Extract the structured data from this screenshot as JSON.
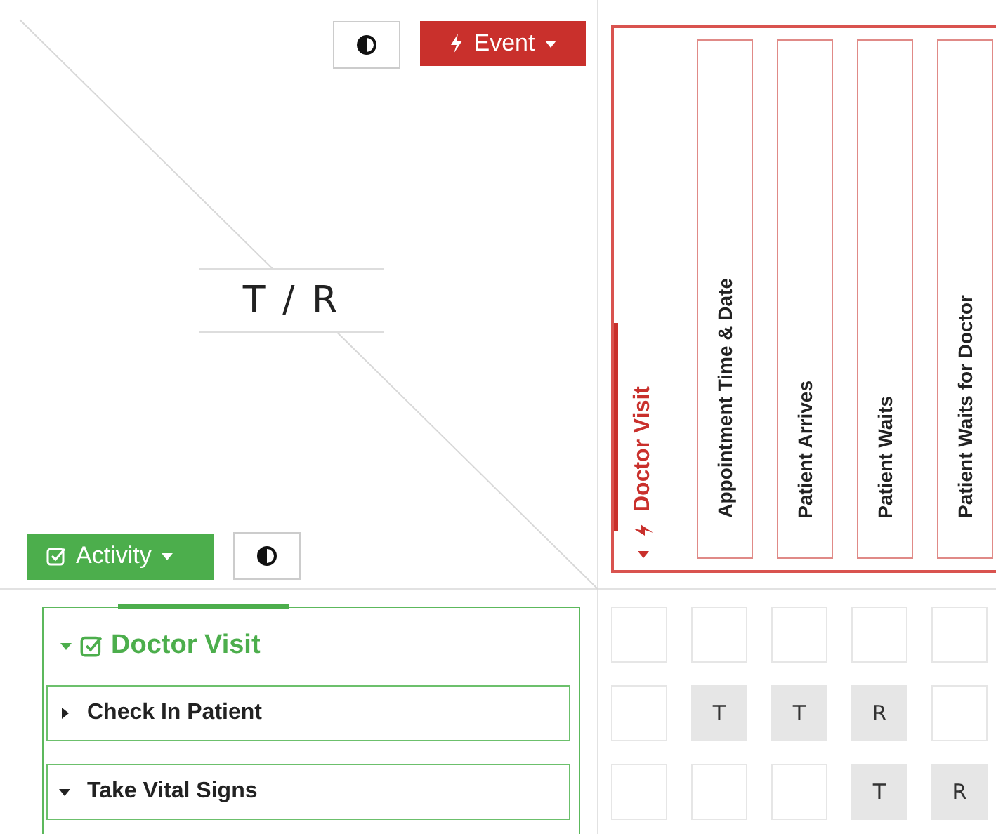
{
  "corner": {
    "label": "T / R",
    "event_button": {
      "label": "Event"
    },
    "activity_button": {
      "label": "Activity"
    }
  },
  "events": {
    "group": {
      "label": "Doctor Visit",
      "expanded": true
    },
    "columns": [
      {
        "label": "Appointment Time & Date"
      },
      {
        "label": "Patient Arrives"
      },
      {
        "label": "Patient Waits"
      },
      {
        "label": "Patient Waits for Doctor"
      }
    ]
  },
  "activities": {
    "group": {
      "label": "Doctor Visit",
      "expanded": true
    },
    "items": [
      {
        "label": "Check In Patient",
        "expanded": false
      },
      {
        "label": "Take Vital Signs",
        "expanded": true
      }
    ]
  },
  "matrix": {
    "rows": [
      {
        "cells": [
          null,
          null,
          null,
          null,
          null
        ]
      },
      {
        "cells": [
          null,
          "T",
          "T",
          "R",
          null
        ]
      },
      {
        "cells": [
          null,
          null,
          null,
          "T",
          "R"
        ]
      }
    ]
  }
}
